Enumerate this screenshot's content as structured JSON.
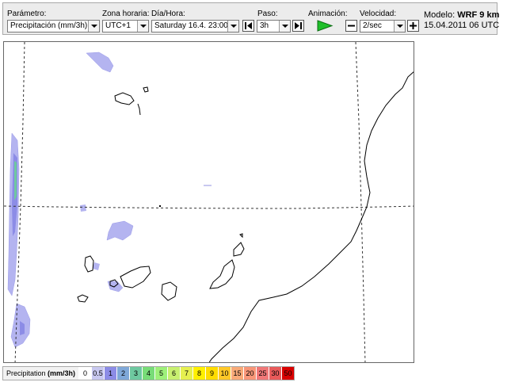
{
  "toolbar": {
    "parametro": {
      "label": "Parámetro:",
      "value": "Precipitación (mm/3h)"
    },
    "zona": {
      "label": "Zona horaria:",
      "value": "UTC+1"
    },
    "diahora": {
      "label": "Día/Hora:",
      "value": "Saturday 16.4. 23:00"
    },
    "paso": {
      "label": "Paso:",
      "value": "3h"
    },
    "animacion": {
      "label": "Animación:"
    },
    "velocidad": {
      "label": "Velocidad:",
      "value": "2/sec"
    },
    "model": {
      "prefix": "Modelo:",
      "name": "WRF 9 km",
      "run": "15.04.2011 06 UTC"
    }
  },
  "icons": [
    "dropdown-arrow-icon",
    "step-back-icon",
    "step-forward-icon",
    "play-icon",
    "minus-icon",
    "plus-icon"
  ],
  "legend": {
    "title": "Precipitation",
    "unit": "(mm/3h)",
    "classes": [
      {
        "label": "0",
        "color": "#ffffff"
      },
      {
        "label": "0.5",
        "color": "#c8c8f0"
      },
      {
        "label": "1",
        "color": "#8c8ce6"
      },
      {
        "label": "2",
        "color": "#7fa8d8"
      },
      {
        "label": "3",
        "color": "#6ec8a0"
      },
      {
        "label": "4",
        "color": "#78dc78"
      },
      {
        "label": "5",
        "color": "#9ef07a"
      },
      {
        "label": "6",
        "color": "#c8f070"
      },
      {
        "label": "7",
        "color": "#e6f050"
      },
      {
        "label": "8",
        "color": "#fff000"
      },
      {
        "label": "9",
        "color": "#ffdc00"
      },
      {
        "label": "10",
        "color": "#ffc828"
      },
      {
        "label": "15",
        "color": "#f8aa78"
      },
      {
        "label": "20",
        "color": "#f89678"
      },
      {
        "label": "25",
        "color": "#f07878"
      },
      {
        "label": "30",
        "color": "#e85a5a"
      },
      {
        "label": "50",
        "color": "#d80000"
      }
    ]
  },
  "colors": {
    "precip_light": "#b4b4f0",
    "precip_medium": "#8c8ce6",
    "precip_core": "#6ec8a0",
    "coastline": "#000000"
  }
}
